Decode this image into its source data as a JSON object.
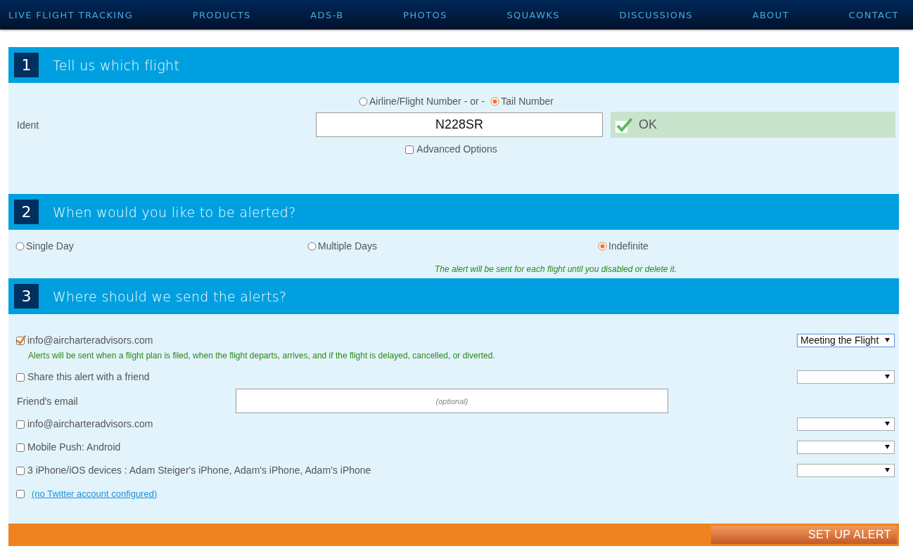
{
  "nav": {
    "items": [
      "LIVE FLIGHT TRACKING",
      "PRODUCTS",
      "ADS-B",
      "PHOTOS",
      "SQUAWKS",
      "DISCUSSIONS",
      "ABOUT",
      "CONTACT"
    ]
  },
  "flight": {
    "number": "1",
    "title": "Tell us which flight",
    "ident_types": [
      {
        "label": "Airline/Flight Number",
        "selected": false
      },
      {
        "label": "Tail Number",
        "selected": true
      }
    ],
    "separator": "- or -",
    "ident_label": "Ident",
    "ident_value": "N228SR",
    "status": {
      "text": "OK",
      "valid": true
    },
    "advanced": {
      "label": "Advanced Options",
      "checked": false
    }
  },
  "when": {
    "number": "2",
    "title": "When would you like to be alerted?",
    "options": [
      {
        "label": "Single Day",
        "selected": false
      },
      {
        "label": "Multiple Days",
        "selected": false
      },
      {
        "label": "Indefinite",
        "selected": true
      }
    ],
    "note": "The alert will be sent for each flight until you disabled or delete it."
  },
  "where": {
    "number": "3",
    "title": "Where should we send the alerts?",
    "rows": [
      {
        "kind": "destination",
        "label": "info@aircharteradvisors.com",
        "checked": true,
        "menu_value": "Meeting the Flight",
        "note": "Alerts will be sent when a flight plan is filed, when the flight departs, arrives, and if the flight is delayed, cancelled, or diverted."
      },
      {
        "kind": "destination",
        "label": "Share this alert with a friend",
        "checked": false,
        "has_menu": true
      },
      {
        "kind": "field",
        "label": "Friend's email",
        "placeholder": "(optional)"
      },
      {
        "kind": "destination",
        "label": "info@aircharteradvisors.com",
        "checked": false,
        "has_menu": true
      },
      {
        "kind": "destination",
        "label": "Mobile Push: Android",
        "checked": false,
        "has_menu": true
      },
      {
        "kind": "destination",
        "label": "3 iPhone/iOS devices : Adam Steiger's iPhone, Adam's iPhone, Adam’s iPhone",
        "checked": false,
        "has_menu": true
      },
      {
        "kind": "link",
        "label": "(no Twitter account configured)",
        "checked": false
      }
    ]
  },
  "submit": {
    "label": "SET UP ALERT"
  }
}
